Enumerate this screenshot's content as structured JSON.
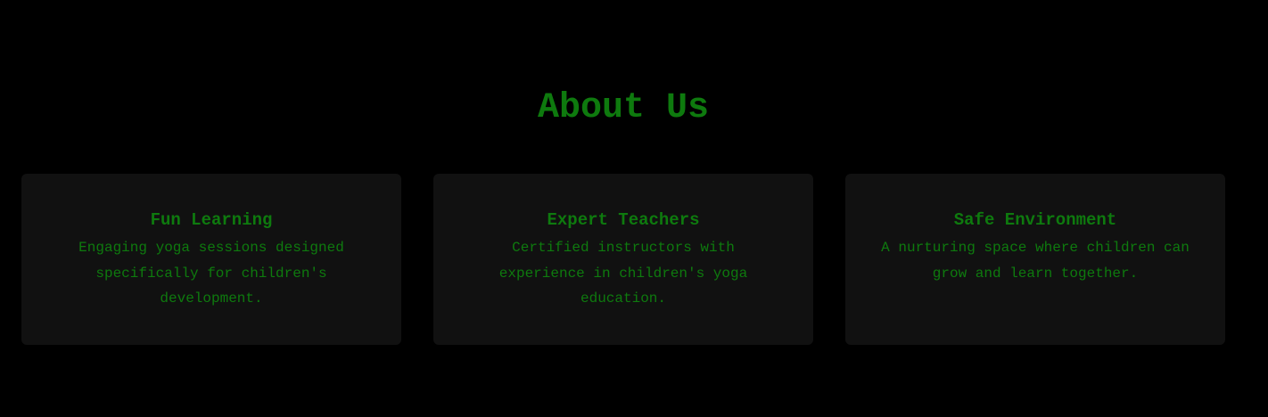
{
  "about": {
    "title": "About Us",
    "cards": [
      {
        "title": "Fun Learning",
        "text": "Engaging yoga sessions designed specifically for children's development."
      },
      {
        "title": "Expert Teachers",
        "text": "Certified instructors with experience in children's yoga education."
      },
      {
        "title": "Safe Environment",
        "text": "A nurturing space where children can grow and learn together."
      }
    ]
  },
  "colors": {
    "background": "#000000",
    "card_background": "#111111",
    "accent_green": "#0e7a0e"
  }
}
